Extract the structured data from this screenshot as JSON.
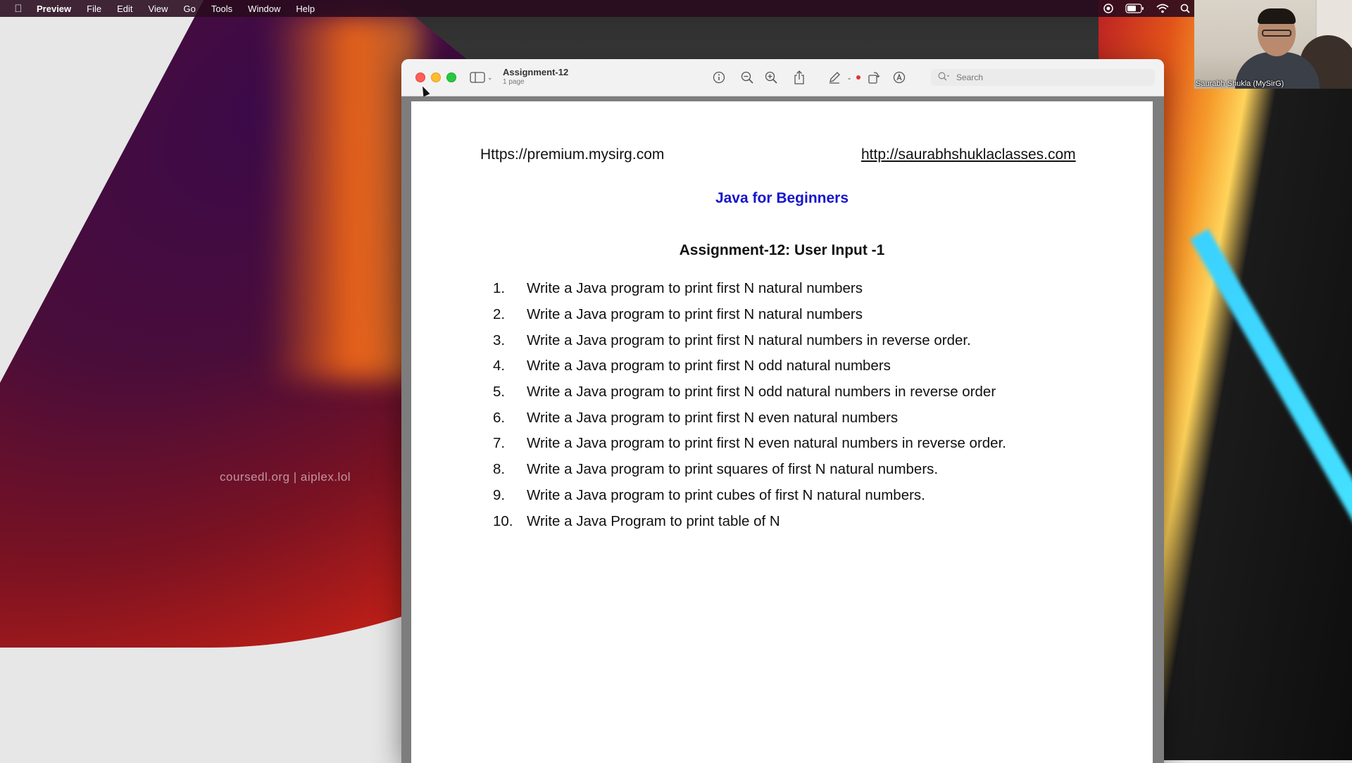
{
  "menubar": {
    "apple_icon": "apple-icon",
    "app_name": "Preview",
    "items": [
      "File",
      "Edit",
      "View",
      "Go",
      "Tools",
      "Window",
      "Help"
    ]
  },
  "window": {
    "title": "Assignment-12",
    "subtitle": "1 page",
    "search_placeholder": "Search",
    "toolbar_icons": [
      "sidebar-icon",
      "info-icon",
      "zoom-out-icon",
      "zoom-in-icon",
      "share-icon",
      "markup-pen-icon",
      "rotate-icon",
      "annotate-icon",
      "search-icon"
    ]
  },
  "document": {
    "link_left": "Https://premium.mysirg.com",
    "link_right": "http://saurabhshuklaclasses.com",
    "course_title": "Java for Beginners",
    "assignment_title": "Assignment-12: User Input -1",
    "questions": [
      {
        "num": "1.",
        "text": "Write a Java program to print first N natural numbers"
      },
      {
        "num": "2.",
        "text": "Write a Java program to print first N natural numbers"
      },
      {
        "num": "3.",
        "text": "Write a Java program to print first N natural numbers in reverse order."
      },
      {
        "num": "4.",
        "text": "Write a Java program to print first N odd natural numbers"
      },
      {
        "num": "5.",
        "text": "Write a Java program to print first N odd natural numbers in reverse order"
      },
      {
        "num": "6.",
        "text": "Write a Java program to print first N even natural numbers"
      },
      {
        "num": "7.",
        "text": "Write a Java program to print first N even natural numbers in reverse order."
      },
      {
        "num": "8.",
        "text": "Write a Java program to print squares of first N natural numbers."
      },
      {
        "num": "9.",
        "text": "Write a Java program to print cubes of first N natural numbers."
      },
      {
        "num": "10.",
        "text": "Write a Java Program to print table of N"
      }
    ]
  },
  "watermark": "coursedl.org | aiplex.lol",
  "webcam": {
    "name_label": "Saurabh Shukla (MySirG)"
  },
  "colors": {
    "course_title": "#1515cc",
    "close_light": "#fe5f57",
    "minimize_light": "#febc2e",
    "zoom_light": "#28c840"
  }
}
